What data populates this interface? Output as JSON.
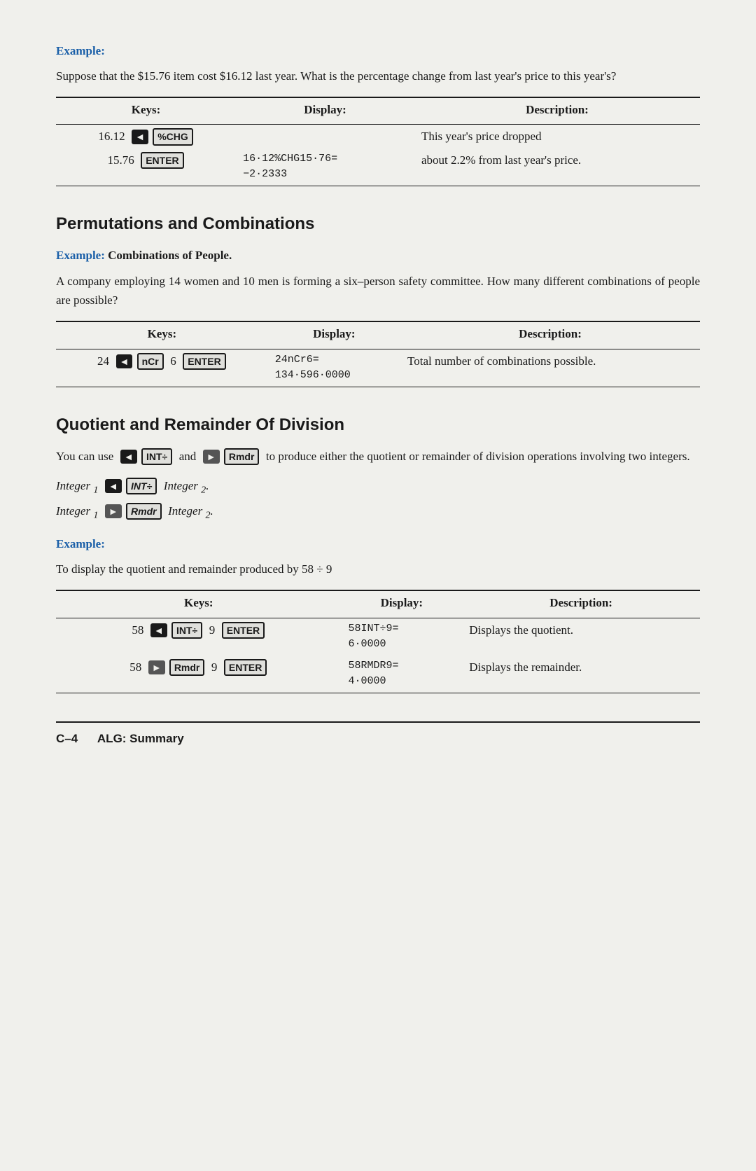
{
  "page": {
    "sections": [
      {
        "id": "example-pct-change",
        "example_label": "Example:",
        "body": "Suppose that the $15.76 item cost $16.12 last year. What is the percentage change from last year's price to this year's?",
        "table": {
          "headers": [
            "Keys:",
            "Display:",
            "Description:"
          ],
          "rows": [
            {
              "keys_text": "16.12  [←]  [%CHG]",
              "display": "",
              "description": "This year's price dropped"
            },
            {
              "keys_text": "15.76  [ENTER]",
              "display": "16·12%CHG15·76=\n−2·2333",
              "description": "about 2.2% from last year's price."
            }
          ]
        }
      },
      {
        "id": "permutations-combinations",
        "heading": "Permutations and Combinations",
        "example_subheading_label": "Example:",
        "example_subheading_rest": " Combinations of People.",
        "body": "A company employing 14 women and 10 men is forming a six–person safety committee. How many different combinations of people are possible?",
        "table": {
          "headers": [
            "Keys:",
            "Display:",
            "Description:"
          ],
          "rows": [
            {
              "keys_text": "24  [■]  [nCr]  6  [ENTER]",
              "display": "24nCr6=\n134·596·0000",
              "description": "Total number of combinations possible."
            }
          ]
        }
      },
      {
        "id": "quotient-remainder",
        "heading": "Quotient and Remainder Of Division",
        "body": "You can use  [■]  [INT÷]  and  [►]  [Rmdr]  to produce either the quotient or remainder of division operations involving two integers.",
        "formula1": "Integer 1  [■]  [INT÷]  Integer 2.",
        "formula2": "Integer 1  [►]  [Rmdr]  Integer 2.",
        "example_label": "Example:",
        "example_body": "To display the quotient and remainder produced by 58 ÷ 9",
        "table": {
          "headers": [
            "Keys:",
            "Display:",
            "Description:"
          ],
          "rows": [
            {
              "keys_text": "58  [■]  [INT÷]  9  [ENTER]",
              "display": "58INT÷9=\n6·0000",
              "description": "Displays the quotient."
            },
            {
              "keys_text": "58  [►]  [Rmdr]  9  [ENTER]",
              "display": "58RMDR9=\n4·0000",
              "description": "Displays the remainder."
            }
          ]
        }
      }
    ],
    "footer": {
      "page_ref": "C–4",
      "title": "ALG: Summary"
    }
  }
}
